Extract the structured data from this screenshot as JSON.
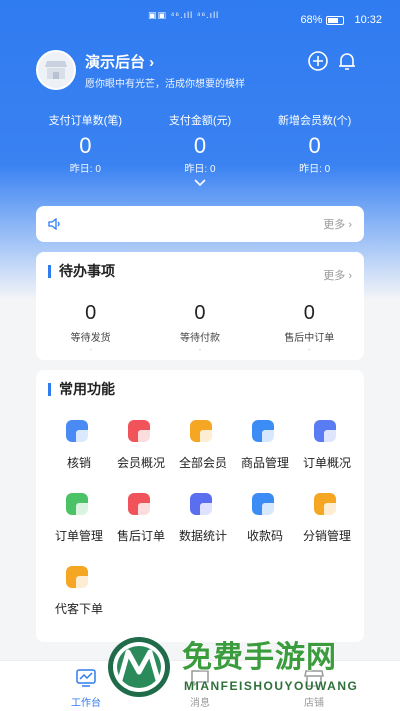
{
  "status_bar": {
    "center_text": "▣▣ ⁴⁶.ıll ⁴⁶.ıll",
    "battery_percent": "68%",
    "time": "10:32"
  },
  "store": {
    "name": "演示后台 ›",
    "slogan": "愿你眼中有光芒，活成你想要的模样"
  },
  "stats": [
    {
      "label": "支付订单数(笔)",
      "value": "0",
      "yesterday": "昨日: 0"
    },
    {
      "label": "支付金额(元)",
      "value": "0",
      "yesterday": "昨日: 0"
    },
    {
      "label": "新增会员数(个)",
      "value": "0",
      "yesterday": "昨日: 0"
    }
  ],
  "notice": {
    "more_label": "更多 ›"
  },
  "todo": {
    "title": "待办事项",
    "more_label": "更多 ›",
    "items": [
      {
        "value": "0",
        "label": "等待发货",
        "dash": "-"
      },
      {
        "value": "0",
        "label": "等待付款",
        "dash": "-"
      },
      {
        "value": "0",
        "label": "售后中订单",
        "dash": "-"
      }
    ]
  },
  "functions": {
    "title": "常用功能",
    "items": [
      {
        "label": "核销",
        "icon": "verify-icon",
        "color": "#4a8af4"
      },
      {
        "label": "会员概况",
        "icon": "member-overview-icon",
        "color": "#f0545a"
      },
      {
        "label": "全部会员",
        "icon": "all-members-icon",
        "color": "#f5a623"
      },
      {
        "label": "商品管理",
        "icon": "cart-icon",
        "color": "#3b8df5"
      },
      {
        "label": "订单概况",
        "icon": "order-overview-icon",
        "color": "#5a7cf2"
      },
      {
        "label": "订单管理",
        "icon": "order-manage-icon",
        "color": "#4cc267"
      },
      {
        "label": "售后订单",
        "icon": "after-sale-icon",
        "color": "#f0545a"
      },
      {
        "label": "数据统计",
        "icon": "stats-icon",
        "color": "#5a6ff0"
      },
      {
        "label": "收款码",
        "icon": "qrcode-icon",
        "color": "#3b8df5"
      },
      {
        "label": "分销管理",
        "icon": "distribution-icon",
        "color": "#f5a623"
      },
      {
        "label": "代客下单",
        "icon": "proxy-order-icon",
        "color": "#f5a623"
      }
    ]
  },
  "tabbar": {
    "items": [
      {
        "label": "工作台",
        "active": true
      },
      {
        "label": "消息",
        "active": false
      },
      {
        "label": "店铺",
        "active": false
      }
    ]
  },
  "watermark": {
    "title": "免费手游网",
    "subtitle": "MIANFEISHOUYOUWANG"
  },
  "colors": {
    "primary": "#2f7bf0",
    "background": "#f4f5f7"
  }
}
